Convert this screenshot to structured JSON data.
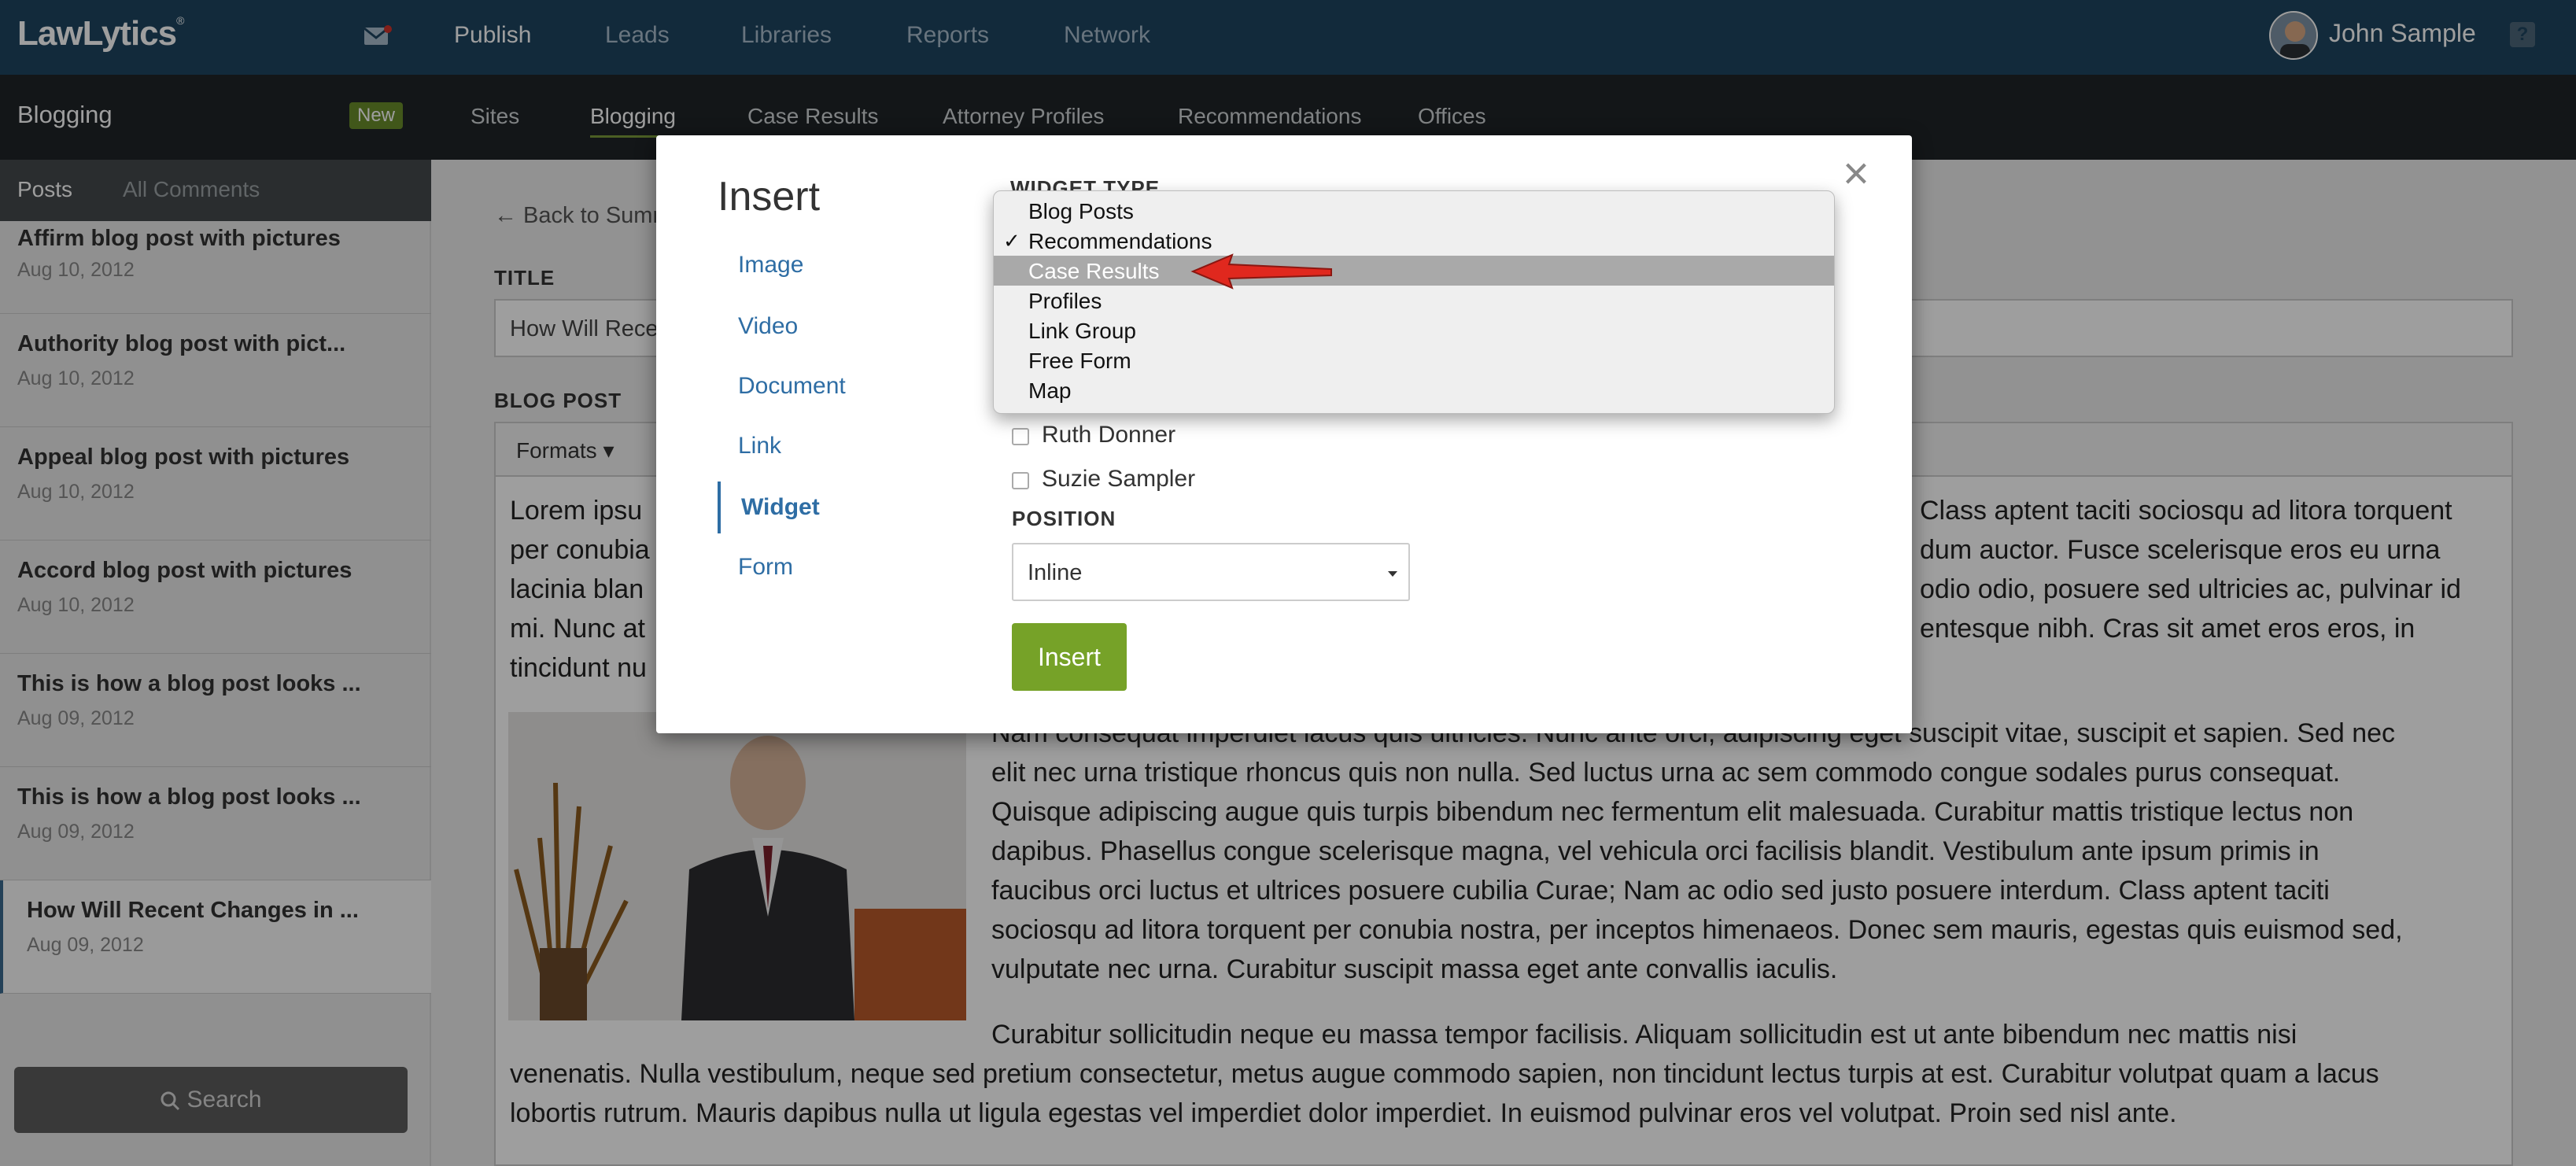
{
  "app": {
    "logo": "LawLytics",
    "logo_mark": "®",
    "nav": [
      "Publish",
      "Leads",
      "Libraries",
      "Reports",
      "Network"
    ],
    "active_nav": "Publish",
    "user": "John Sample",
    "help": "?"
  },
  "subheader": {
    "section": "Blogging",
    "badge": "New",
    "links": [
      "Sites",
      "Blogging",
      "Case Results",
      "Attorney Profiles",
      "Recommendations",
      "Offices"
    ]
  },
  "sidebar": {
    "tabs": [
      "Posts",
      "All Comments"
    ],
    "posts": [
      {
        "title": "Affirm blog post with pictures",
        "date": "Aug 10, 2012"
      },
      {
        "title": "Authority blog post with pict...",
        "date": "Aug 10, 2012"
      },
      {
        "title": "Appeal blog post with pictures",
        "date": "Aug 10, 2012"
      },
      {
        "title": "Accord blog post with pictures",
        "date": "Aug 10, 2012"
      },
      {
        "title": "This is how a blog post looks ...",
        "date": "Aug 09, 2012"
      },
      {
        "title": "This is how a blog post looks ...",
        "date": "Aug 09, 2012"
      },
      {
        "title": "How Will Recent Changes in ...",
        "date": "Aug 09, 2012"
      }
    ],
    "search_label": "Search"
  },
  "main": {
    "back_link": "← Back to Summ",
    "title_label": "TITLE",
    "title_value": "How Will Rece",
    "post_label": "BLOG POST",
    "formats": "Formats",
    "p1": [
      "Lorem ipsu",
      "per conubia",
      "lacinia blan",
      "mi. Nunc at",
      "tincidunt nu"
    ],
    "p1_right": [
      "Class aptent taciti sociosqu ad litora torquent",
      "dum auctor. Fusce scelerisque eros eu urna",
      "odio odio, posuere sed ultricies ac, pulvinar id",
      "entesque nibh. Cras sit amet eros eros, in"
    ],
    "p2": [
      "Nam consequat imperdiet lacus quis ultricies. Nunc ante orci, adipiscing eget suscipit vitae, suscipit et sapien. Sed nec",
      "elit nec urna tristique rhoncus quis non nulla. Sed luctus urna ac sem commodo congue sodales purus consequat.",
      "Quisque adipiscing augue quis turpis bibendum nec fermentum elit malesuada. Curabitur mattis tristique lectus non",
      "dapibus. Phasellus congue scelerisque magna, vel vehicula orci facilisis blandit. Vestibulum ante ipsum primis in",
      "faucibus orci luctus et ultrices posuere cubilia Curae; Nam ac odio sed justo posuere interdum. Class aptent taciti",
      "sociosqu ad litora torquent per conubia nostra, per inceptos himenaeos. Donec sem mauris, egestas quis euismod sed,",
      "vulputate nec urna. Curabitur suscipit massa eget ante convallis iaculis."
    ],
    "p3": [
      "Curabitur sollicitudin neque eu massa tempor facilisis. Aliquam sollicitudin est ut ante bibendum nec mattis nisi",
      "venenatis. Nulla vestibulum, neque sed pretium consectetur, metus augue commodo sapien, non tincidunt lectus turpis at est. Curabitur volutpat quam a lacus",
      "lobortis rutrum. Mauris dapibus nulla ut ligula egestas vel imperdiet dolor imperdiet. In euismod pulvinar eros vel volutpat. Proin sed nisl ante."
    ]
  },
  "modal": {
    "title": "Insert",
    "close": "×",
    "links": [
      "Image",
      "Video",
      "Document",
      "Link",
      "Widget",
      "Form"
    ],
    "active_link": "Widget",
    "widget_type_label": "WIDGET TYPE",
    "dropdown_options": [
      "Blog Posts",
      "Recommendations",
      "Case Results",
      "Profiles",
      "Link Group",
      "Free Form",
      "Map"
    ],
    "checked_option": "Recommendations",
    "highlighted_option": "Case Results",
    "checkmark": "✓",
    "checkboxes": [
      "Ruth Donner",
      "Suzie Sampler"
    ],
    "position_label": "POSITION",
    "position_value": "Inline",
    "insert_button": "Insert"
  },
  "colors": {
    "topbar": "#1d4460",
    "subbar": "#1f2428",
    "accent_green": "#76a228",
    "link_blue": "#2e6da4",
    "annotation_arrow": "#e0281e"
  }
}
